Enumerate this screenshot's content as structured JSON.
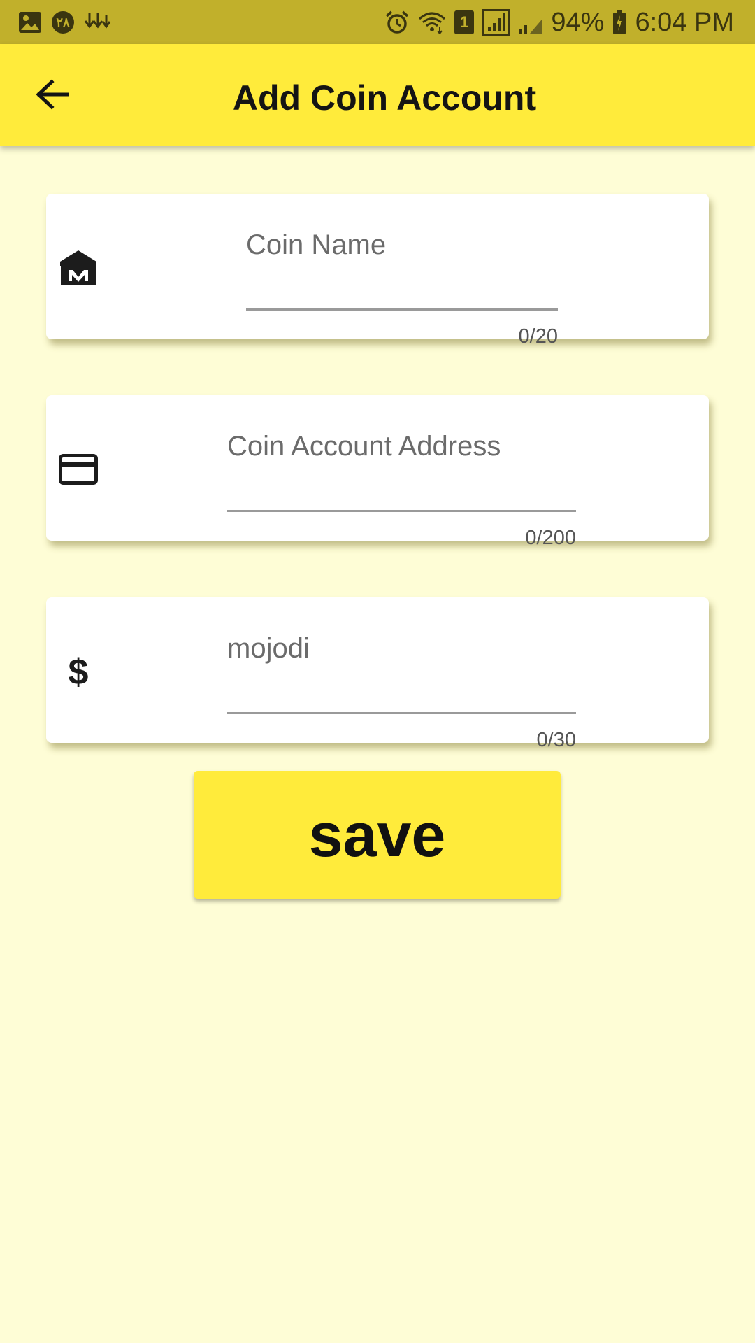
{
  "status_bar": {
    "left_icons": [
      "image-icon",
      "notification-badge-icon",
      "download-icon"
    ],
    "badge_text": "۲۸",
    "right_icons": [
      "alarm-icon",
      "wifi-icon",
      "sim-icon",
      "signal-icon",
      "signal-icon",
      "battery-charging-icon"
    ],
    "sim_number": "1",
    "battery": "94%",
    "time": "6:04 PM"
  },
  "app_bar": {
    "title": "Add Coin Account",
    "back_icon": "arrow-back-icon"
  },
  "form": {
    "fields": [
      {
        "icon": "bank-icon",
        "placeholder": "Coin Name",
        "value": "",
        "counter": "0/20"
      },
      {
        "icon": "credit-card-icon",
        "placeholder": "Coin Account Address",
        "value": "",
        "counter": "0/200"
      },
      {
        "icon": "dollar-icon",
        "placeholder": "mojodi",
        "value": "",
        "counter": "0/30"
      }
    ],
    "save_label": "save"
  },
  "colors": {
    "status_bar": "#c1b02b",
    "app_bar": "#ffeb3b",
    "background": "#fefdd6",
    "button": "#ffeb3b"
  }
}
